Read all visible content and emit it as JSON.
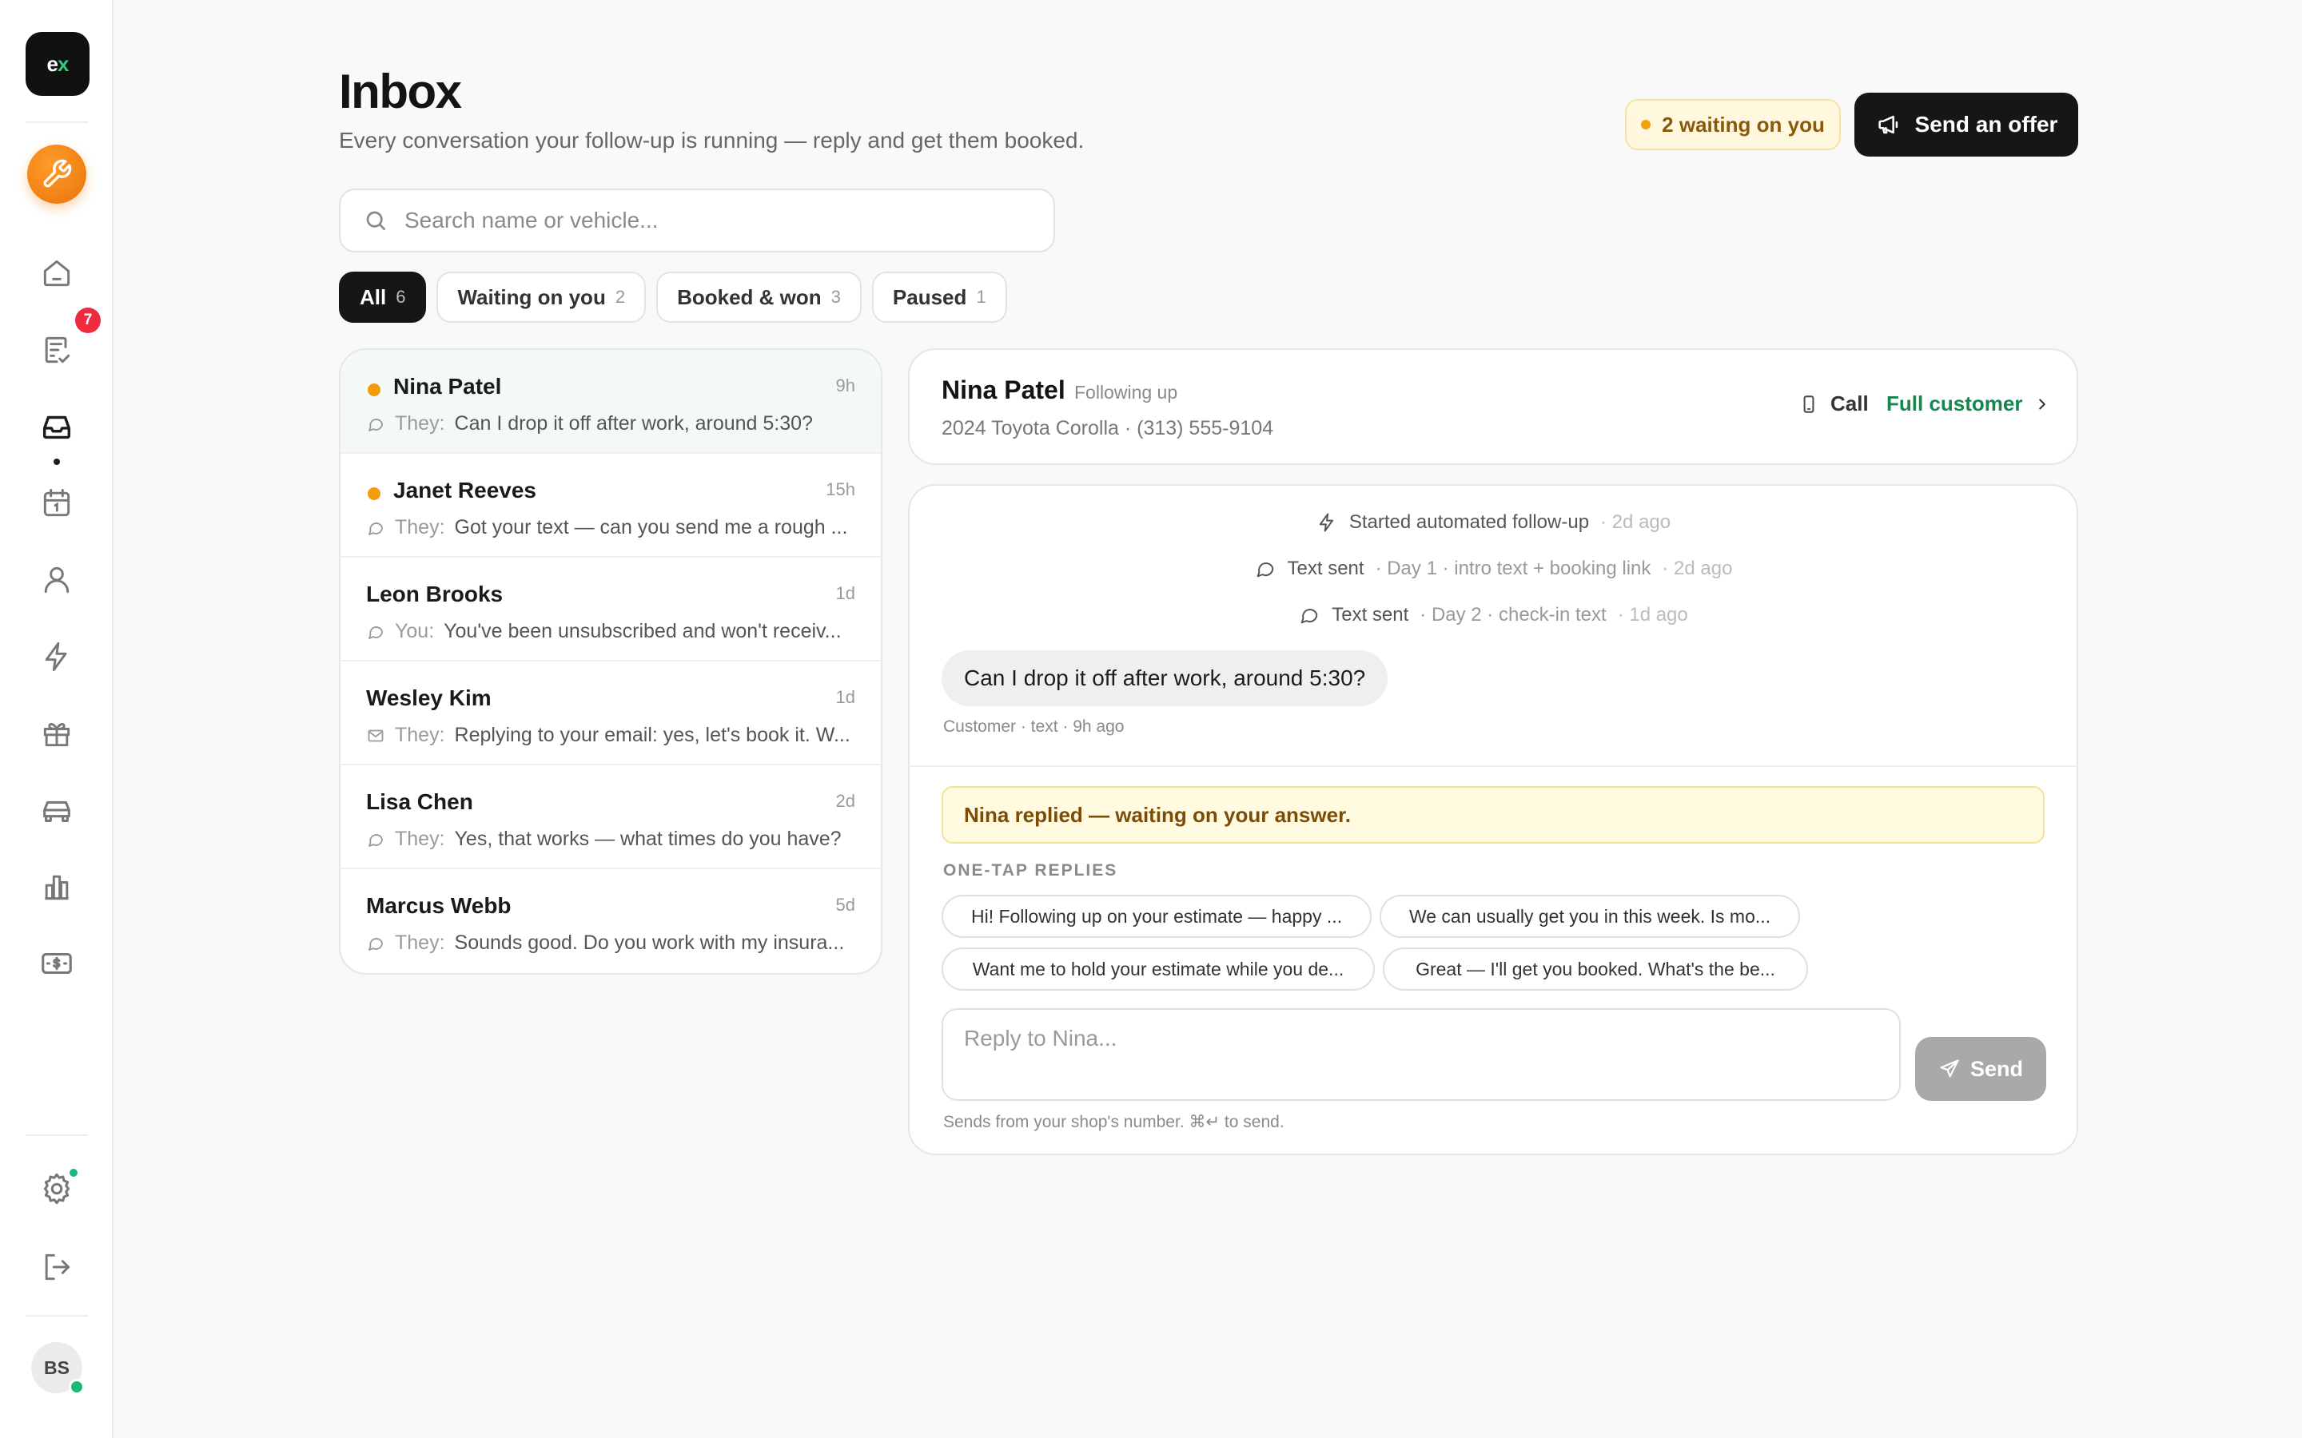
{
  "sidebar": {
    "logo_text_a": "e",
    "logo_text_b": "x",
    "badge_count": "7",
    "avatar_initials": "BS",
    "icons": [
      "wrench-icon",
      "home-icon",
      "estimates-icon",
      "inbox-icon",
      "calendar-icon",
      "user-icon",
      "bolt-icon",
      "gift-icon",
      "car-icon",
      "chart-icon",
      "money-icon",
      "settings-icon",
      "logout-icon"
    ]
  },
  "header": {
    "title": "Inbox",
    "subtitle": "Every conversation your follow-up is running — reply and get them booked.",
    "waiting_label": "2 waiting on you",
    "offer_label": "Send an offer"
  },
  "search": {
    "placeholder": "Search name or vehicle..."
  },
  "filters": [
    {
      "label": "All",
      "count": "6"
    },
    {
      "label": "Waiting on you",
      "count": "2"
    },
    {
      "label": "Booked & won",
      "count": "3"
    },
    {
      "label": "Paused",
      "count": "1"
    }
  ],
  "conversations": [
    {
      "name": "Nina Patel",
      "time": "9h",
      "who": "They:",
      "preview": "Can I drop it off after work, around 5:30?",
      "channel": "text",
      "unread": true,
      "selected": true
    },
    {
      "name": "Janet Reeves",
      "time": "15h",
      "who": "They:",
      "preview": "Got your text — can you send me a rough ...",
      "channel": "text",
      "unread": true
    },
    {
      "name": "Leon Brooks",
      "time": "1d",
      "who": "You:",
      "preview": "You've been unsubscribed and won't receiv...",
      "channel": "text"
    },
    {
      "name": "Wesley Kim",
      "time": "1d",
      "who": "They:",
      "preview": "Replying to your email: yes, let's book it. W...",
      "channel": "email"
    },
    {
      "name": "Lisa Chen",
      "time": "2d",
      "who": "They:",
      "preview": "Yes, that works — what times do you have?",
      "channel": "text"
    },
    {
      "name": "Marcus Webb",
      "time": "5d",
      "who": "They:",
      "preview": "Sounds good. Do you work with my insura...",
      "channel": "text"
    }
  ],
  "detail": {
    "name": "Nina Patel",
    "status": "Following up",
    "vehicle_phone": "2024 Toyota Corolla · (313) 555-9104",
    "call_label": "Call",
    "full_label": "Full customer",
    "events": [
      {
        "icon": "bolt-icon",
        "label": "Started automated follow-up",
        "meta": "",
        "ago": "· 2d ago"
      },
      {
        "icon": "chat-icon",
        "label": "Text sent",
        "meta": "· Day 1 · intro text + booking link",
        "ago": "· 2d ago"
      },
      {
        "icon": "chat-icon",
        "label": "Text sent",
        "meta": "· Day 2 · check-in text",
        "ago": "· 1d ago"
      }
    ],
    "message": "Can I drop it off after work, around 5:30?",
    "message_meta": "Customer · text · 9h ago",
    "alert": "Nina replied — waiting on your answer.",
    "quick_label": "ONE-TAP REPLIES",
    "quick_replies": [
      "Hi! Following up on your estimate — happy ...",
      "We can usually get you in this week. Is mo...",
      "Want me to hold your estimate while you de...",
      "Great — I'll get you booked. What's the be..."
    ],
    "reply_placeholder": "Reply to Nina...",
    "send_label": "Send",
    "hint": "Sends from your shop's number. ⌘↵ to send."
  },
  "colors": {
    "accent_green": "#15884e",
    "unread_dot": "#f29c0c",
    "badge_red": "#ef2b3d",
    "orange": "#e8730a"
  }
}
